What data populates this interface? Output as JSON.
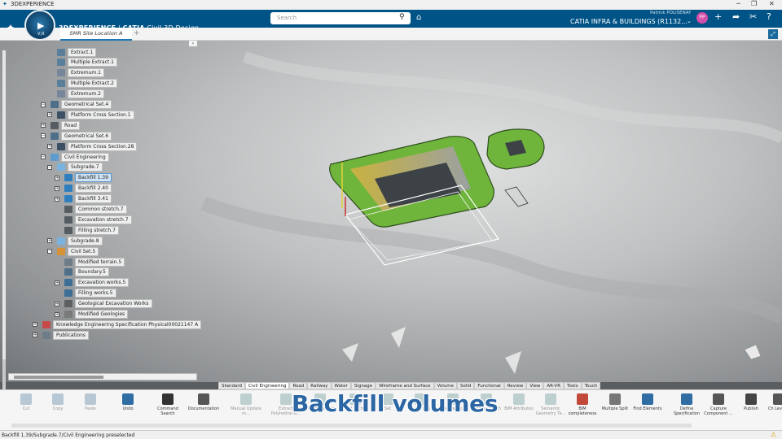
{
  "window": {
    "title": "3DEXPERIENCE",
    "controls": [
      "─",
      "❐",
      "✕"
    ]
  },
  "app": {
    "brand": "3DEXPERIENCE",
    "product": "CATIA",
    "app_name": "Civil 3D Design",
    "compass_label": "V,R"
  },
  "search": {
    "placeholder": "Search"
  },
  "user": {
    "name": "Patrick POLISENAY",
    "initials": "PP"
  },
  "context": {
    "label": "CATIA INFRA & BUILDINGS (R1132..."
  },
  "tabs": [
    {
      "label": "SMR Site Location A",
      "active": true
    }
  ],
  "tree": [
    {
      "label": "Extract.1",
      "icon": "extract-icon",
      "level": 3
    },
    {
      "label": "Multiple Extract.1",
      "icon": "multi-extract-icon",
      "level": 3
    },
    {
      "label": "Extremum.1",
      "icon": "extremum-icon",
      "level": 3
    },
    {
      "label": "Multiple Extract.2",
      "icon": "multi-extract-icon",
      "level": 3
    },
    {
      "label": "Extremum.2",
      "icon": "extremum-icon",
      "level": 3
    },
    {
      "label": "Geometrical Set.4",
      "icon": "geometrical-set-icon",
      "level": 2,
      "expander": "−"
    },
    {
      "label": "Platform Cross Section.1",
      "icon": "cross-section-icon",
      "level": 3,
      "expander": "+"
    },
    {
      "label": "Road",
      "icon": "road-icon",
      "level": 2,
      "expander": "+"
    },
    {
      "label": "Geometrical Set.6",
      "icon": "geometrical-set-icon",
      "level": 2,
      "expander": "−"
    },
    {
      "label": "Platform Cross Section.28",
      "icon": "cross-section-icon",
      "level": 3,
      "expander": "+"
    },
    {
      "label": "Civil Engineering",
      "icon": "civil-engineering-icon",
      "level": 2,
      "expander": "−"
    },
    {
      "label": "Subgrade.7",
      "icon": "subgrade-icon",
      "level": 3,
      "expander": "−"
    },
    {
      "label": "Backfill 1.39",
      "icon": "backfill-icon",
      "level": 4,
      "expander": "+",
      "selected": true
    },
    {
      "label": "Backfill 2.40",
      "icon": "backfill-icon",
      "level": 4,
      "expander": "+"
    },
    {
      "label": "Backfill 3.41",
      "icon": "backfill-icon",
      "level": 4,
      "expander": "+"
    },
    {
      "label": "Common stretch.7",
      "icon": "stretch-icon",
      "level": 4
    },
    {
      "label": "Excavation stretch.7",
      "icon": "stretch-icon",
      "level": 4
    },
    {
      "label": "Filling stretch.7",
      "icon": "stretch-icon",
      "level": 4
    },
    {
      "label": "Subgrade.8",
      "icon": "subgrade-icon",
      "level": 3,
      "expander": "+"
    },
    {
      "label": "Civil Set.5",
      "icon": "civil-set-icon",
      "level": 3,
      "expander": "−"
    },
    {
      "label": "Modified terrain.5",
      "icon": "terrain-icon",
      "level": 4
    },
    {
      "label": "Boundary.5",
      "icon": "boundary-icon",
      "level": 4
    },
    {
      "label": "Excavation works.5",
      "icon": "excavation-icon",
      "level": 4,
      "expander": "+"
    },
    {
      "label": "Filling works.5",
      "icon": "filling-icon",
      "level": 4
    },
    {
      "label": "Geological Excavation Works",
      "icon": "geological-icon",
      "level": 4,
      "expander": "+"
    },
    {
      "label": "Modified Geologies",
      "icon": "geology-icon",
      "level": 4,
      "expander": "+"
    },
    {
      "label": "Knowledge Engineering Specification Physical00021147 A",
      "icon": "knowledge-icon",
      "level": 1,
      "expander": "+"
    },
    {
      "label": "Publications",
      "icon": "publications-icon",
      "level": 1,
      "expander": "+"
    }
  ],
  "section_tabs": [
    "Standard",
    "Civil Engineering",
    "Road",
    "Railway",
    "Water",
    "Signage",
    "Wireframe and Surface",
    "Volume",
    "Solid",
    "Functional",
    "Review",
    "View",
    "AR-VR",
    "Tools",
    "Touch"
  ],
  "active_section_tab": "Civil Engineering",
  "tools": [
    {
      "label": "Cut",
      "icon": "cut-icon",
      "enabled": false
    },
    {
      "label": "Copy",
      "icon": "copy-icon",
      "enabled": false
    },
    {
      "label": "Paste",
      "icon": "paste-icon",
      "enabled": false
    },
    {
      "label": "Undo",
      "icon": "undo-icon",
      "enabled": true
    },
    {
      "label": "Command Search",
      "icon": "command-search-icon",
      "enabled": true
    },
    {
      "label": "Documentation",
      "icon": "documentation-icon",
      "enabled": true
    },
    {
      "label": "Manual Update m...",
      "icon": "manual-update-icon",
      "enabled": false
    },
    {
      "label": "Extract Polyhedral G...",
      "icon": "extract-polyhedral-icon",
      "enabled": false
    },
    {
      "label": "Design Terrain",
      "icon": "design-terrain-icon",
      "enabled": false
    },
    {
      "label": "Solid Section",
      "icon": "solid-section-icon",
      "enabled": false
    },
    {
      "label": "Set",
      "icon": "set-icon",
      "enabled": false
    },
    {
      "label": "Subgrade",
      "icon": "subgrade-tool-icon",
      "enabled": false
    },
    {
      "label": "Earthworks",
      "icon": "earthworks-icon",
      "enabled": false
    },
    {
      "label": "Create Stretch",
      "icon": "stretch-tool-icon",
      "enabled": false
    },
    {
      "label": "BIM Attributes",
      "icon": "bim-attributes-icon",
      "enabled": false
    },
    {
      "label": "Semantic Geometry Ta...",
      "icon": "semantic-geometry-icon",
      "enabled": false
    },
    {
      "label": "BIM completeness",
      "icon": "bim-completeness-icon",
      "enabled": true
    },
    {
      "label": "Multiple Split",
      "icon": "multiple-split-icon",
      "enabled": true
    },
    {
      "label": "Find Elements",
      "icon": "find-elements-icon",
      "enabled": true
    },
    {
      "label": "Define Specification",
      "icon": "define-spec-icon",
      "enabled": true
    },
    {
      "label": "Capture Component ...",
      "icon": "capture-component-icon",
      "enabled": true
    },
    {
      "label": "Publish",
      "icon": "publish-icon",
      "enabled": true
    },
    {
      "label": "Ch Level o",
      "icon": "level-icon",
      "enabled": true
    }
  ],
  "caption": "Backfill volumes",
  "status": {
    "text": "Backfill 1.39/Subgrade.7/Civil Engineering preselected"
  },
  "colors": {
    "topbar": "#005386",
    "accent": "#1a77b8",
    "backfill_green": "#6fb53c",
    "backfill_yellow": "#c9b23f"
  }
}
